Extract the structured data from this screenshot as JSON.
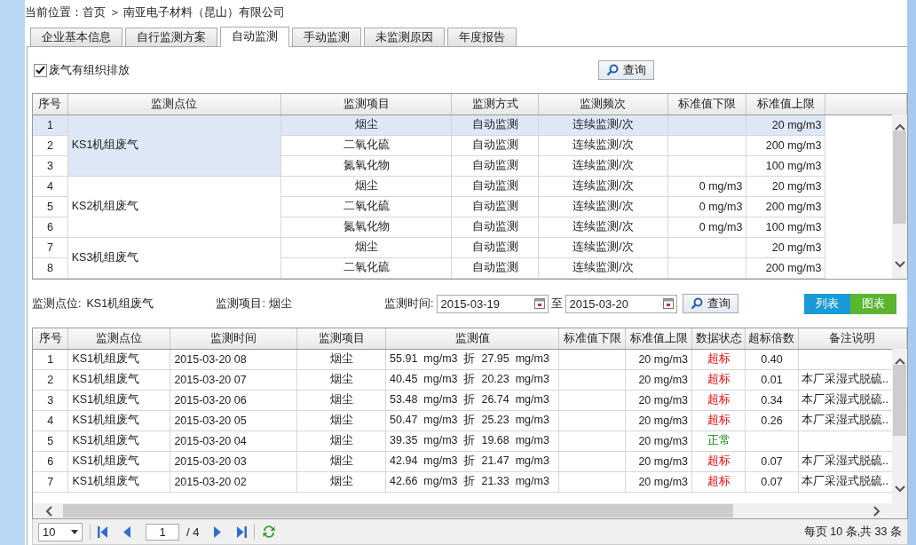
{
  "breadcrumb": "当前位置：首页 ＞ 南亚电子材料（昆山）有限公司",
  "tabs": [
    {
      "label": "企业基本信息",
      "selected": false
    },
    {
      "label": "自行监测方案",
      "selected": false
    },
    {
      "label": "自动监测",
      "selected": true
    },
    {
      "label": "手动监测",
      "selected": false
    },
    {
      "label": "未监测原因",
      "selected": false
    },
    {
      "label": "年度报告",
      "selected": false
    }
  ],
  "filter": {
    "label": "废气有组织排放",
    "checked": true,
    "button": "查询"
  },
  "plan_table": {
    "columns": [
      "序号",
      "监测点位",
      "监测项目",
      "监测方式",
      "监测频次",
      "标准值下限",
      "标准值上限"
    ],
    "groups": [
      {
        "point": "KS1机组废气",
        "rows": [
          {
            "no": "1",
            "item": "烟尘",
            "method": "自动监测",
            "freq": "连续监测/次",
            "lower": "",
            "upper": "20 mg/m3",
            "selected": true
          },
          {
            "no": "2",
            "item": "二氧化硫",
            "method": "自动监测",
            "freq": "连续监测/次",
            "lower": "",
            "upper": "200 mg/m3",
            "selected": false
          },
          {
            "no": "3",
            "item": "氮氧化物",
            "method": "自动监测",
            "freq": "连续监测/次",
            "lower": "",
            "upper": "100 mg/m3",
            "selected": false
          }
        ]
      },
      {
        "point": "KS2机组废气",
        "rows": [
          {
            "no": "4",
            "item": "烟尘",
            "method": "自动监测",
            "freq": "连续监测/次",
            "lower": "0 mg/m3",
            "upper": "20 mg/m3",
            "selected": false
          },
          {
            "no": "5",
            "item": "二氧化硫",
            "method": "自动监测",
            "freq": "连续监测/次",
            "lower": "0 mg/m3",
            "upper": "200 mg/m3",
            "selected": false
          },
          {
            "no": "6",
            "item": "氮氧化物",
            "method": "自动监测",
            "freq": "连续监测/次",
            "lower": "0 mg/m3",
            "upper": "100 mg/m3",
            "selected": false
          }
        ]
      },
      {
        "point": "KS3机组废气",
        "rows": [
          {
            "no": "7",
            "item": "烟尘",
            "method": "自动监测",
            "freq": "连续监测/次",
            "lower": "",
            "upper": "20 mg/m3",
            "selected": false
          },
          {
            "no": "8",
            "item": "二氧化硫",
            "method": "自动监测",
            "freq": "连续监测/次",
            "lower": "",
            "upper": "200 mg/m3",
            "selected": false
          }
        ]
      }
    ]
  },
  "query": {
    "point_label": "监测点位:",
    "point": "KS1机组废气",
    "item_label": "监测项目:",
    "item": "烟尘",
    "time_label": "监测时间:",
    "from": "2015-03-19",
    "to_label": "至",
    "to": "2015-03-20",
    "button": "查询",
    "views": [
      {
        "label": "列表",
        "color": "#1a9ad6"
      },
      {
        "label": "图表",
        "color": "#5cb531"
      }
    ]
  },
  "data_table": {
    "columns": [
      "序号",
      "监测点位",
      "监测时间",
      "监测项目",
      "监测值",
      "标准值下限",
      "标准值上限",
      "数据状态",
      "超标倍数",
      "备注说明"
    ],
    "rows": [
      {
        "no": "1",
        "point": "KS1机组废气",
        "time": "2015-03-20 08",
        "item": "烟尘",
        "value": "55.91  mg/m3  折  27.95  mg/m3",
        "lower": "",
        "upper": "20 mg/m3",
        "status": "超标",
        "kind": "over",
        "ratio": "0.40",
        "note": ""
      },
      {
        "no": "2",
        "point": "KS1机组废气",
        "time": "2015-03-20 07",
        "item": "烟尘",
        "value": "40.45  mg/m3  折  20.23  mg/m3",
        "lower": "",
        "upper": "20 mg/m3",
        "status": "超标",
        "kind": "over",
        "ratio": "0.01",
        "note": "本厂采湿式脱硫.."
      },
      {
        "no": "3",
        "point": "KS1机组废气",
        "time": "2015-03-20 06",
        "item": "烟尘",
        "value": "53.48  mg/m3  折  26.74  mg/m3",
        "lower": "",
        "upper": "20 mg/m3",
        "status": "超标",
        "kind": "over",
        "ratio": "0.34",
        "note": "本厂采湿式脱硫.."
      },
      {
        "no": "4",
        "point": "KS1机组废气",
        "time": "2015-03-20 05",
        "item": "烟尘",
        "value": "50.47  mg/m3  折  25.23  mg/m3",
        "lower": "",
        "upper": "20 mg/m3",
        "status": "超标",
        "kind": "over",
        "ratio": "0.26",
        "note": "本厂采湿式脱硫.."
      },
      {
        "no": "5",
        "point": "KS1机组废气",
        "time": "2015-03-20 04",
        "item": "烟尘",
        "value": "39.35  mg/m3  折  19.68  mg/m3",
        "lower": "",
        "upper": "20 mg/m3",
        "status": "正常",
        "kind": "normal",
        "ratio": "",
        "note": ""
      },
      {
        "no": "6",
        "point": "KS1机组废气",
        "time": "2015-03-20 03",
        "item": "烟尘",
        "value": "42.94  mg/m3  折  21.47  mg/m3",
        "lower": "",
        "upper": "20 mg/m3",
        "status": "超标",
        "kind": "over",
        "ratio": "0.07",
        "note": "本厂采湿式脱硫.."
      },
      {
        "no": "7",
        "point": "KS1机组废气",
        "time": "2015-03-20 02",
        "item": "烟尘",
        "value": "42.66  mg/m3  折  21.33  mg/m3",
        "lower": "",
        "upper": "20 mg/m3",
        "status": "超标",
        "kind": "over",
        "ratio": "0.07",
        "note": "本厂采湿式脱硫.."
      }
    ]
  },
  "pager": {
    "page_size": "10",
    "page": "1",
    "total_pages": "/ 4",
    "summary": "每页 10 条,共 33 条"
  }
}
